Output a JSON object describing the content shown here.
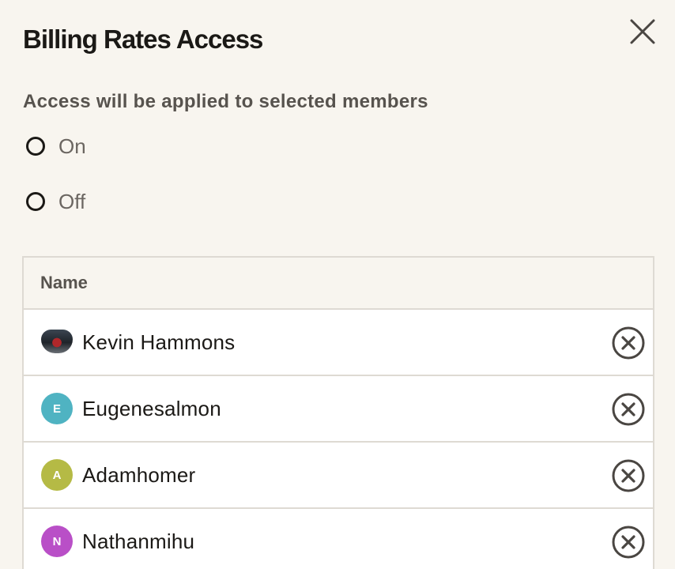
{
  "dialog": {
    "title": "Billing Rates Access",
    "close_icon": "close-icon"
  },
  "access": {
    "subtitle": "Access will be applied to selected members",
    "options": [
      {
        "label": "On",
        "selected": false
      },
      {
        "label": "Off",
        "selected": false
      }
    ]
  },
  "members_table": {
    "header": "Name",
    "rows": [
      {
        "name": "Kevin Hammons",
        "avatar_type": "photo",
        "avatar_letter": "",
        "avatar_color": "#3c4652"
      },
      {
        "name": "Eugenesalmon",
        "avatar_type": "initial",
        "avatar_letter": "E",
        "avatar_color": "#4fb3c2"
      },
      {
        "name": "Adamhomer",
        "avatar_type": "initial",
        "avatar_letter": "A",
        "avatar_color": "#b5ba45"
      },
      {
        "name": "Nathanmihu",
        "avatar_type": "initial",
        "avatar_letter": "N",
        "avatar_color": "#b94fc7"
      }
    ],
    "remove_icon": "remove-circle-icon"
  },
  "colors": {
    "background": "#f8f5ef",
    "border": "#dedad3",
    "text_dark": "#1b1916",
    "text_muted": "#57534e"
  }
}
